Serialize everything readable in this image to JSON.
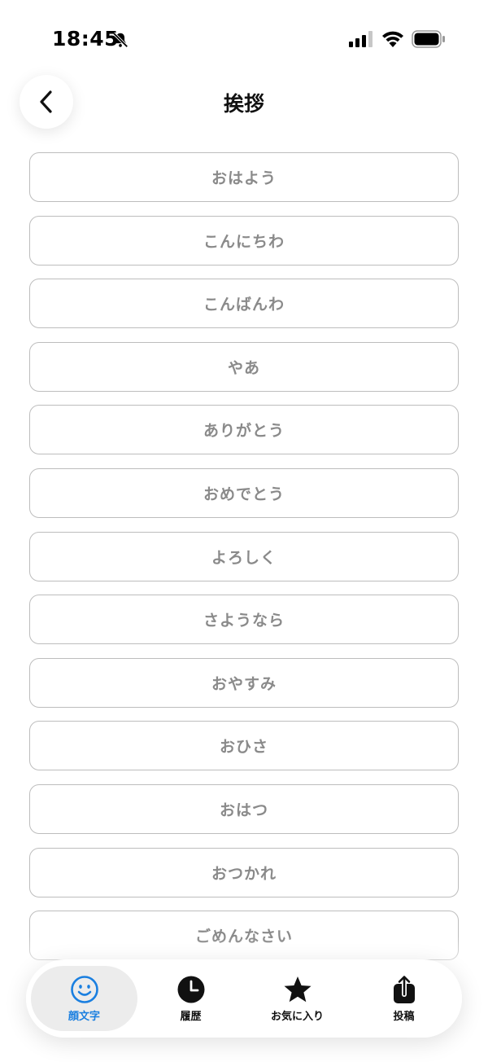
{
  "status_bar": {
    "time": "18:45",
    "icons": [
      "bell-off-icon",
      "signal-icon",
      "wifi-icon",
      "battery-icon"
    ]
  },
  "header": {
    "title": "挨拶",
    "back_icon": "chevron-left-icon"
  },
  "list": {
    "items": [
      "おはよう",
      "こんにちわ",
      "こんばんわ",
      "やあ",
      "ありがとう",
      "おめでとう",
      "よろしく",
      "さようなら",
      "おやすみ",
      "おひさ",
      "おはつ",
      "おつかれ",
      "ごめんなさい"
    ]
  },
  "tab_bar": {
    "tabs": [
      {
        "label": "顔文字",
        "icon": "smiley-icon",
        "active": true
      },
      {
        "label": "履歴",
        "icon": "clock-icon",
        "active": false
      },
      {
        "label": "お気に入り",
        "icon": "star-icon",
        "active": false
      },
      {
        "label": "投稿",
        "icon": "share-icon",
        "active": false
      }
    ]
  },
  "colors": {
    "accent": "#1a7fe0",
    "item_text": "#8a8a8a",
    "item_border": "#bdbdbd"
  }
}
